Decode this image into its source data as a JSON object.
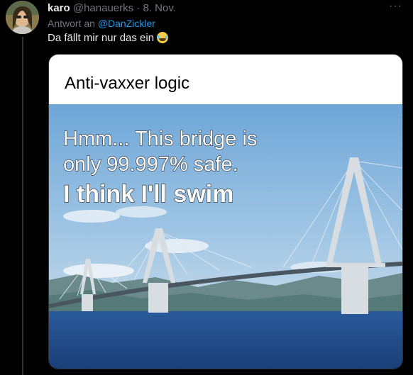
{
  "tweet": {
    "display_name": "karo",
    "handle": "@hanauerks",
    "separator": "·",
    "date": "8. Nov.",
    "more_label": "···",
    "reply_prefix": "Antwort an",
    "reply_to": "@DanZickler",
    "text": "Da fällt mir nur das ein",
    "emoji": "face-with-tears-of-joy"
  },
  "meme": {
    "title": "Anti-vaxxer logic",
    "line1": "Hmm... This bridge is",
    "line2": "only 99.997% safe.",
    "line3": "I think I'll swim"
  },
  "colors": {
    "background": "#000000",
    "name": "#e7e9ea",
    "muted": "#71767b",
    "link": "#1d9bf0"
  }
}
